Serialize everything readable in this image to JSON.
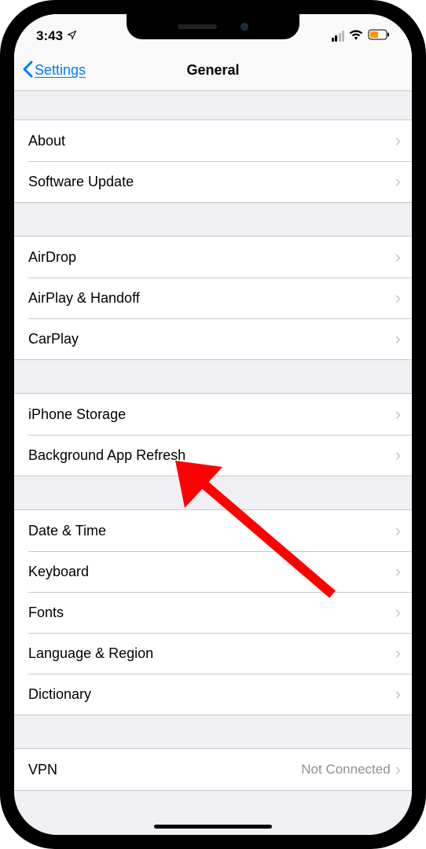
{
  "status": {
    "time": "3:43",
    "location_icon": "location-arrow-icon",
    "signal_bars_filled": 2,
    "wifi": "wifi-icon",
    "battery_icon": "battery-icon"
  },
  "nav": {
    "back_label": "Settings",
    "title": "General"
  },
  "sections": [
    {
      "rows": [
        {
          "name": "about",
          "label": "About"
        },
        {
          "name": "software-update",
          "label": "Software Update"
        }
      ]
    },
    {
      "rows": [
        {
          "name": "airdrop",
          "label": "AirDrop"
        },
        {
          "name": "airplay-handoff",
          "label": "AirPlay & Handoff"
        },
        {
          "name": "carplay",
          "label": "CarPlay"
        }
      ]
    },
    {
      "rows": [
        {
          "name": "iphone-storage",
          "label": "iPhone Storage"
        },
        {
          "name": "background-app-refresh",
          "label": "Background App Refresh"
        }
      ]
    },
    {
      "rows": [
        {
          "name": "date-time",
          "label": "Date & Time"
        },
        {
          "name": "keyboard",
          "label": "Keyboard"
        },
        {
          "name": "fonts",
          "label": "Fonts"
        },
        {
          "name": "language-region",
          "label": "Language & Region"
        },
        {
          "name": "dictionary",
          "label": "Dictionary"
        }
      ]
    },
    {
      "rows": [
        {
          "name": "vpn",
          "label": "VPN",
          "value": "Not Connected"
        }
      ]
    }
  ],
  "annotation": {
    "type": "arrow",
    "color": "#ff0000",
    "target": "iphone-storage"
  }
}
